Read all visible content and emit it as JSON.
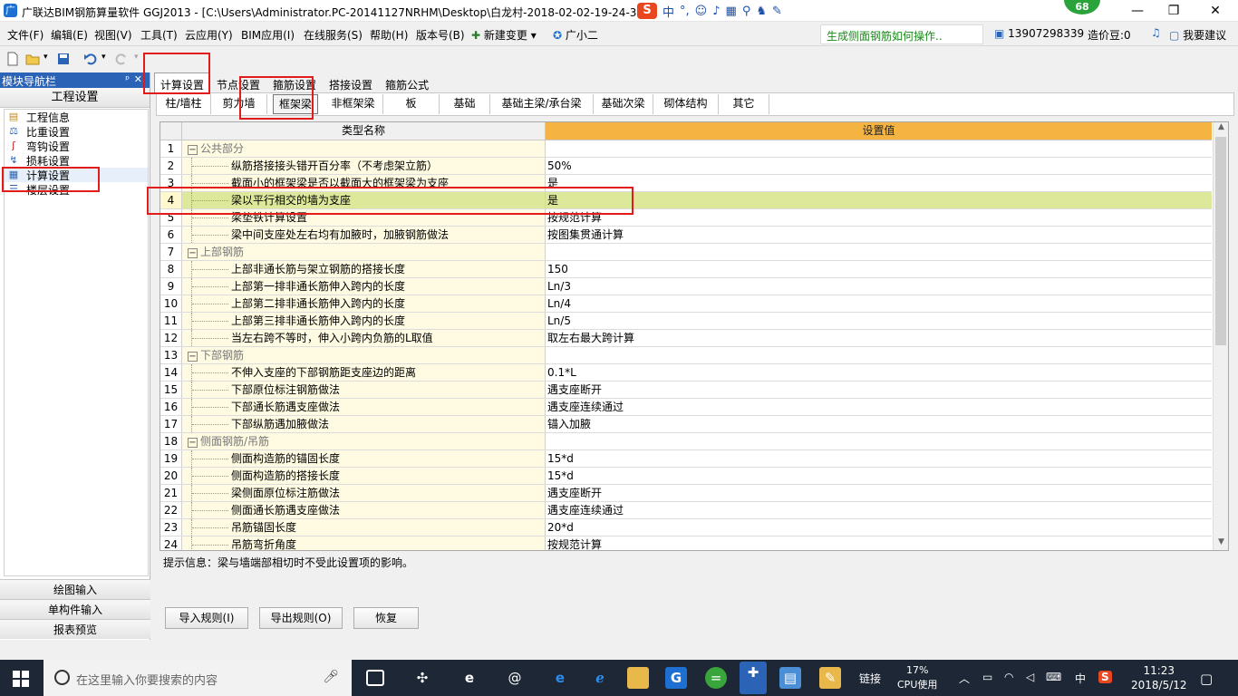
{
  "window": {
    "title": "广联达BIM钢筋算量软件 GGJ2013 - [C:\\Users\\Administrator.PC-20141127NRHM\\Desktop\\白龙村-2018-02-02-19-24-35",
    "ime_mode": "中",
    "score_badge": "68"
  },
  "menu": {
    "items": [
      "文件(F)",
      "编辑(E)",
      "视图(V)",
      "工具(T)",
      "云应用(Y)",
      "BIM应用(I)",
      "在线服务(S)",
      "帮助(H)",
      "版本号(B)"
    ],
    "new_change": "新建变更",
    "xiaoer": "广小二",
    "message": "生成侧面钢筋如何操作..",
    "user": "13907298339",
    "beans": "造价豆:0",
    "suggest": "我要建议"
  },
  "nav": {
    "header": "模块导航栏",
    "group": "工程设置",
    "items": [
      "工程信息",
      "比重设置",
      "弯钩设置",
      "损耗设置",
      "计算设置",
      "楼层设置"
    ],
    "bottom": [
      "绘图输入",
      "单构件输入",
      "报表预览"
    ]
  },
  "tabs": [
    "计算设置",
    "节点设置",
    "箍筋设置",
    "搭接设置",
    "箍筋公式"
  ],
  "subtabs": [
    "柱/墙柱",
    "剪力墙",
    "框架梁",
    "非框架梁",
    "板",
    "基础",
    "基础主梁/承台梁",
    "基础次梁",
    "砌体结构",
    "其它"
  ],
  "grid": {
    "col_name": "类型名称",
    "col_value": "设置值",
    "rows": [
      {
        "n": "1",
        "name": "公共部分",
        "value": "",
        "group": true
      },
      {
        "n": "2",
        "name": "纵筋搭接接头错开百分率（不考虑架立筋）",
        "value": "50%"
      },
      {
        "n": "3",
        "name": "截面小的框架梁是否以截面大的框架梁为支座",
        "value": "是"
      },
      {
        "n": "4",
        "name": "梁以平行相交的墙为支座",
        "value": "是",
        "selected": true
      },
      {
        "n": "5",
        "name": "梁垫铁计算设置",
        "value": "按规范计算"
      },
      {
        "n": "6",
        "name": "梁中间支座处左右均有加腋时，加腋钢筋做法",
        "value": "按图集贯通计算"
      },
      {
        "n": "7",
        "name": "上部钢筋",
        "value": "",
        "group": true
      },
      {
        "n": "8",
        "name": "上部非通长筋与架立钢筋的搭接长度",
        "value": "150"
      },
      {
        "n": "9",
        "name": "上部第一排非通长筋伸入跨内的长度",
        "value": "Ln/3"
      },
      {
        "n": "10",
        "name": "上部第二排非通长筋伸入跨内的长度",
        "value": "Ln/4"
      },
      {
        "n": "11",
        "name": "上部第三排非通长筋伸入跨内的长度",
        "value": "Ln/5"
      },
      {
        "n": "12",
        "name": "当左右跨不等时，伸入小跨内负筋的L取值",
        "value": "取左右最大跨计算"
      },
      {
        "n": "13",
        "name": "下部钢筋",
        "value": "",
        "group": true
      },
      {
        "n": "14",
        "name": "不伸入支座的下部钢筋距支座边的距离",
        "value": "0.1*L"
      },
      {
        "n": "15",
        "name": "下部原位标注钢筋做法",
        "value": "遇支座断开"
      },
      {
        "n": "16",
        "name": "下部通长筋遇支座做法",
        "value": "遇支座连续通过"
      },
      {
        "n": "17",
        "name": "下部纵筋遇加腋做法",
        "value": "锚入加腋"
      },
      {
        "n": "18",
        "name": "侧面钢筋/吊筋",
        "value": "",
        "group": true
      },
      {
        "n": "19",
        "name": "侧面构造筋的锚固长度",
        "value": "15*d"
      },
      {
        "n": "20",
        "name": "侧面构造筋的搭接长度",
        "value": "15*d"
      },
      {
        "n": "21",
        "name": "梁侧面原位标注筋做法",
        "value": "遇支座断开"
      },
      {
        "n": "22",
        "name": "侧面通长筋遇支座做法",
        "value": "遇支座连续通过"
      },
      {
        "n": "23",
        "name": "吊筋锚固长度",
        "value": "20*d"
      },
      {
        "n": "24",
        "name": "吊筋弯折角度",
        "value": "按规范计算"
      }
    ]
  },
  "hint": "提示信息：梁与墙端部相切时不受此设置项的影响。",
  "buttons": [
    "导入规则(I)",
    "导出规则(O)",
    "恢复"
  ],
  "taskbar": {
    "search_placeholder": "在这里输入你要搜索的内容",
    "link_label": "链接",
    "cpu_percent": "17%",
    "cpu_label": "CPU使用",
    "ime": "中",
    "time": "11:23",
    "date": "2018/5/12"
  },
  "colors": {
    "accent": "#2b63b6",
    "header_orange": "#f5b441",
    "selected_row": "#dde89a",
    "annotation_red": "#e21b1b"
  }
}
